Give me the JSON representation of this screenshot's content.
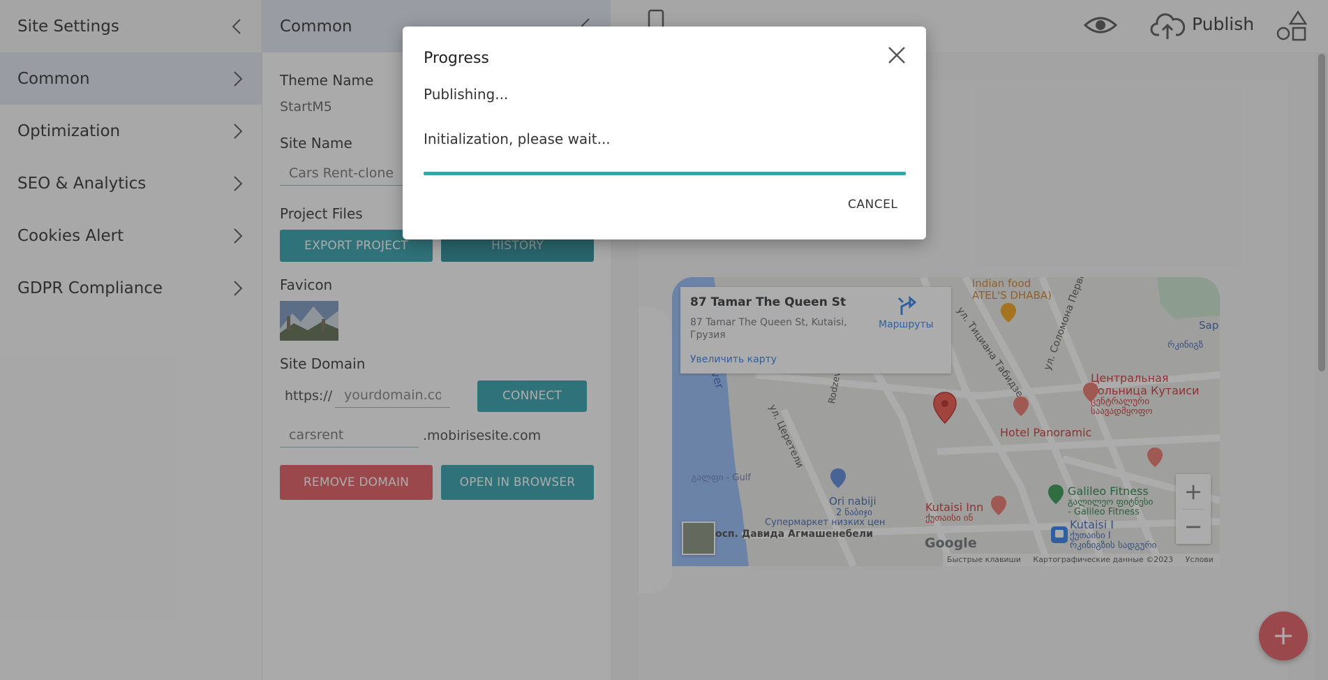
{
  "sidebar": {
    "header": "Site Settings",
    "items": [
      {
        "label": "Common"
      },
      {
        "label": "Optimization"
      },
      {
        "label": "SEO & Analytics"
      },
      {
        "label": "Cookies Alert"
      },
      {
        "label": "GDPR Compliance"
      }
    ]
  },
  "panel": {
    "title": "Common",
    "theme_name_label": "Theme Name",
    "theme_name_value": "StartM5",
    "site_name_label": "Site Name",
    "site_name_value": "Cars Rent-clone",
    "project_files_label": "Project Files",
    "export_label": "EXPORT PROJECT",
    "history_label": "HISTORY",
    "favicon_label": "Favicon",
    "site_domain_label": "Site Domain",
    "https_prefix": "https://",
    "domain_placeholder": "yourdomain.com",
    "connect_label": "CONNECT",
    "subdomain_value": "carsrent",
    "subdomain_suffix": ".mobirisesite.com",
    "remove_domain_label": "REMOVE DOMAIN",
    "open_browser_label": "OPEN IN BROWSER"
  },
  "topbar": {
    "publish_label": "Publish"
  },
  "map": {
    "place_title": "87 Tamar The Queen St",
    "place_address": "87 Tamar The Queen St, Kutaisi, Грузия",
    "routes_label": "Маршруты",
    "enlarge_label": "Увеличить карту",
    "labels": {
      "indian_food": "Indian food",
      "dhaba": "ATEL'S DHABA)",
      "river": "River",
      "central_hospital": "Центральная",
      "central_hospital_2": "больница Кутаиси",
      "hospital_geo": "ცენტრალური",
      "hospital_geo_2": "საავადმყოფო",
      "hotel_panoramic": "Hotel Panoramic",
      "gulf": "გალფი - Gulf",
      "ori_nabiji": "Ori nabiji",
      "ori_nabiji_geo": "2 ნაბიჯი",
      "supermarket": "Супермаркет низких цен",
      "kutaisi_inn": "Kutaisi Inn",
      "kutaisi_inn_geo": "ქუთაისი ინ",
      "galileo": "Galileo Fitness",
      "galileo_geo": "გალილეო ფიტნესი",
      "galileo_geo_2": "- Galileo Fitness",
      "kutaisi_1": "Kutaisi I",
      "kutaisi_1_geo": "ქუთაისი I",
      "kutaisi_1_geo_2": "რკინიგზის სადგური",
      "agmashenebeli": "осп. Давида Агмашенебели",
      "tsereteli": "ул. Церетели",
      "tabidze": "ул. Тициана Табидзе",
      "solomon": "ул. Соломона Первого",
      "rodzev": "Rodzev",
      "sap": "Sap",
      "railway_geo": "რკინიგზ"
    },
    "zoom_in": "+",
    "zoom_out": "−",
    "google": "Google",
    "footer_shortcuts": "Быстрые клавиши",
    "footer_data": "Картографические данные ©2023",
    "footer_terms": "Услови"
  },
  "fab_label": "+",
  "modal": {
    "title": "Progress",
    "status": "Publishing...",
    "message": "Initialization, please wait...",
    "progress_percent": 100,
    "cancel_label": "CANCEL"
  },
  "colors": {
    "accent_teal": "#1d96a3",
    "danger_red": "#e14a50",
    "progress_teal": "#3aa2ad"
  }
}
